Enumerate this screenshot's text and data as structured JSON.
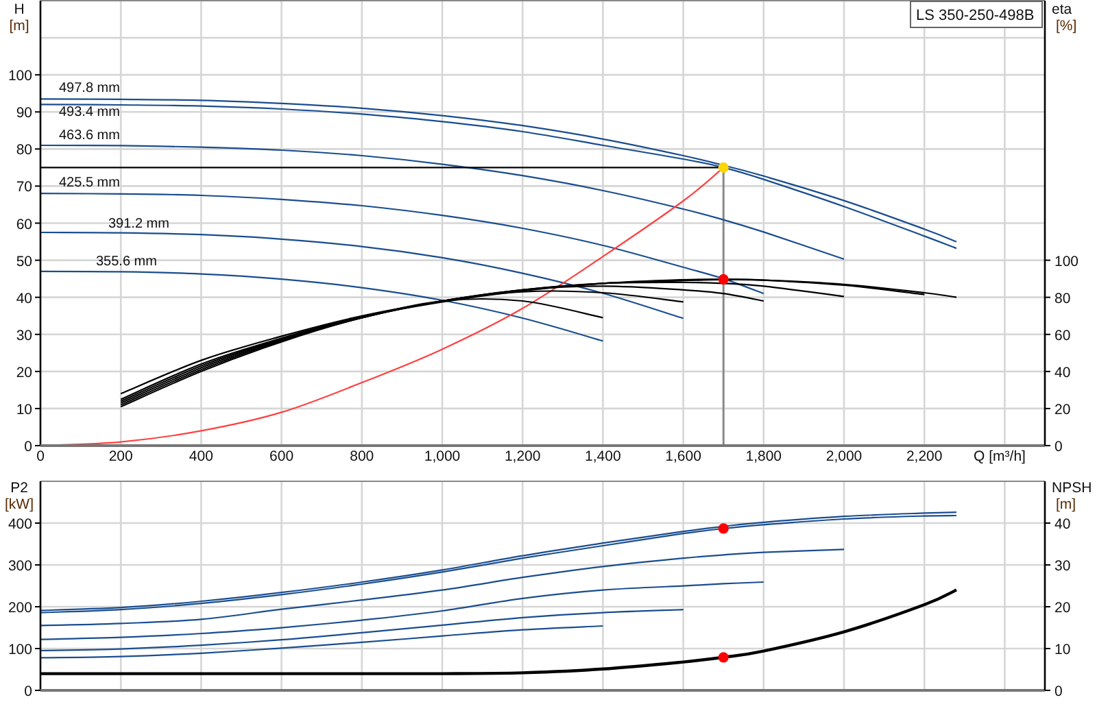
{
  "head_chart": {
    "axis_title": "H",
    "axis_unit": "[m]",
    "chart_data": {
      "type": "line",
      "title": "LS 350-250-498B",
      "xlabel": "Q [m³/h]",
      "grid": true,
      "xlim": [
        0,
        2500
      ],
      "ylim": [
        0,
        120
      ],
      "xticks": [
        0,
        200,
        400,
        600,
        800,
        {
          "value": 1000,
          "label": "1,000"
        },
        {
          "value": 1200,
          "label": "1,200"
        },
        {
          "value": 1400,
          "label": "1,400"
        },
        {
          "value": 1600,
          "label": "1,600"
        },
        {
          "value": 1800,
          "label": "1,800"
        },
        {
          "value": 2000,
          "label": "2,000"
        },
        {
          "value": 2200,
          "label": "2,200"
        }
      ],
      "yticks": [
        0,
        10,
        20,
        30,
        40,
        50,
        60,
        70,
        80,
        90,
        100
      ],
      "x": [
        0,
        200,
        400,
        600,
        800,
        1000,
        1200,
        1400,
        1600,
        1700,
        1800,
        2000,
        2200,
        2280
      ],
      "series": [
        {
          "name": "497.8 mm",
          "color": "#1a4d8f",
          "values": [
            93.5,
            93.4,
            93.1,
            92.3,
            91.0,
            89.0,
            86.3,
            82.7,
            78.2,
            75.6,
            72.7,
            66.1,
            58.4,
            55.0
          ]
        },
        {
          "name": "493.4 mm",
          "color": "#1a4d8f",
          "values": [
            92,
            91.9,
            91.6,
            90.8,
            89.4,
            87.4,
            84.7,
            81.0,
            77.3,
            75.0,
            71.8,
            64.5,
            56.5,
            53.2
          ]
        },
        {
          "name": "463.6 mm",
          "color": "#1a4d8f",
          "values": [
            81,
            80.9,
            80.5,
            79.7,
            78.2,
            75.9,
            72.8,
            68.8,
            63.8,
            60.9,
            57.6,
            50.3,
            null,
            null
          ]
        },
        {
          "name": "425.5 mm",
          "color": "#1a4d8f",
          "values": [
            68,
            67.9,
            67.5,
            66.4,
            64.7,
            62.1,
            58.6,
            54.0,
            48.1,
            45.0,
            41.0,
            null,
            null,
            null
          ]
        },
        {
          "name": "391.2 mm",
          "color": "#1a4d8f",
          "values": [
            57.5,
            57.4,
            56.9,
            55.7,
            53.7,
            50.7,
            46.5,
            41.1,
            34.3,
            null,
            null,
            null,
            null,
            null
          ]
        },
        {
          "name": "355.6 mm",
          "color": "#1a4d8f",
          "values": [
            47,
            46.9,
            46.3,
            44.9,
            42.6,
            39.2,
            34.4,
            28.2,
            null,
            null,
            null,
            null,
            null,
            null
          ]
        },
        {
          "color": "#ff4040",
          "values": [
            0,
            1,
            4,
            9,
            17,
            26,
            37,
            51,
            66,
            75,
            null,
            null,
            null,
            null
          ]
        },
        {
          "color": "#000000",
          "values": [
            75,
            75,
            75,
            75,
            75,
            75,
            75,
            75,
            75,
            75,
            null,
            null,
            null,
            null
          ]
        },
        {
          "color": "#ffd700",
          "marker": true,
          "values": [
            null,
            null,
            null,
            null,
            null,
            null,
            null,
            null,
            null,
            75,
            null,
            null,
            null,
            null
          ]
        }
      ],
      "ref_lines": [
        {
          "axis": "x",
          "value": 1700
        }
      ]
    }
  },
  "efficiency_chart": {
    "axis_title": "eta",
    "axis_unit": "[%]",
    "chart_data": {
      "type": "line",
      "xlim": [
        0,
        2500
      ],
      "ylim": [
        0,
        240
      ],
      "yticks": [
        0,
        20,
        40,
        60,
        80,
        100
      ],
      "x": [
        200,
        400,
        600,
        800,
        1000,
        1200,
        1400,
        1600,
        1700,
        1800,
        2000,
        2200,
        2280
      ],
      "series": [
        {
          "color": "#000000",
          "values": [
            28,
            46,
            59,
            70,
            78,
            84,
            87.5,
            89,
            89.5,
            89.3,
            87,
            82.5,
            80
          ]
        },
        {
          "color": "#000000",
          "values": [
            25,
            44,
            58,
            69.5,
            77.5,
            83.5,
            87.5,
            89.5,
            89.7,
            89.3,
            86.5,
            81.5,
            null
          ]
        },
        {
          "color": "#000000",
          "values": [
            24,
            43,
            57.5,
            69,
            78,
            84,
            87.5,
            88,
            87.5,
            86,
            80.5,
            null,
            null
          ]
        },
        {
          "color": "#000000",
          "values": [
            23,
            42,
            57,
            69,
            78,
            84,
            86,
            84,
            82,
            78,
            null,
            null,
            null
          ]
        },
        {
          "color": "#000000",
          "values": [
            22,
            41,
            56.5,
            69,
            78,
            83,
            82.5,
            77.5,
            null,
            null,
            null,
            null,
            null
          ]
        },
        {
          "color": "#000000",
          "values": [
            21,
            40,
            56,
            69,
            78,
            78,
            69,
            null,
            null,
            null,
            null,
            null,
            null
          ]
        },
        {
          "color": "#ff0000",
          "marker": true,
          "values": [
            null,
            null,
            null,
            null,
            null,
            null,
            null,
            null,
            89.7,
            null,
            null,
            null,
            null
          ]
        }
      ]
    }
  },
  "power_chart": {
    "axis_title": "P2",
    "axis_unit": "[kW]",
    "chart_data": {
      "type": "line",
      "grid": true,
      "xlim": [
        0,
        2500
      ],
      "ylim": [
        0,
        500
      ],
      "yticks": [
        0,
        100,
        200,
        300,
        400
      ],
      "x": [
        0,
        200,
        400,
        600,
        800,
        1000,
        1200,
        1400,
        1600,
        1700,
        1800,
        2000,
        2200,
        2280
      ],
      "series": [
        {
          "color": "#1a4d8f",
          "values": [
            191,
            198,
            213,
            234,
            259,
            288,
            322,
            352,
            380,
            392,
            402,
            416,
            424,
            426
          ]
        },
        {
          "color": "#1a4d8f",
          "values": [
            186,
            193,
            208,
            229,
            254,
            283,
            316,
            346,
            375,
            387,
            396,
            410,
            417,
            418
          ]
        },
        {
          "color": "#1a4d8f",
          "values": [
            155,
            160,
            170,
            194,
            216,
            240,
            270,
            296,
            316,
            324,
            330,
            337,
            null,
            null
          ]
        },
        {
          "color": "#1a4d8f",
          "values": [
            122,
            127,
            136,
            150,
            168,
            190,
            220,
            240,
            250,
            255,
            259,
            null,
            null,
            null
          ]
        },
        {
          "color": "#1a4d8f",
          "values": [
            95,
            99,
            108,
            121,
            138,
            156,
            174,
            186,
            193,
            null,
            null,
            null,
            null,
            null
          ]
        },
        {
          "color": "#1a4d8f",
          "values": [
            78,
            81,
            89,
            101,
            115,
            130,
            145,
            154,
            null,
            null,
            null,
            null,
            null,
            null
          ]
        },
        {
          "color": "#ff0000",
          "marker": true,
          "values": [
            null,
            null,
            null,
            null,
            null,
            null,
            null,
            null,
            null,
            387,
            null,
            null,
            null,
            null
          ]
        }
      ]
    }
  },
  "npsh_chart": {
    "axis_title": "NPSH",
    "axis_unit": "[m]",
    "chart_data": {
      "type": "line",
      "xlim": [
        0,
        2500
      ],
      "ylim": [
        0,
        50
      ],
      "yticks": [
        0,
        10,
        20,
        30,
        40
      ],
      "x": [
        0,
        200,
        400,
        600,
        800,
        1000,
        1200,
        1400,
        1600,
        1700,
        1800,
        2000,
        2200,
        2280
      ],
      "series": [
        {
          "color": "#000000",
          "values": [
            4,
            4,
            4,
            4,
            4,
            4,
            4.2,
            5.1,
            6.8,
            7.9,
            9.4,
            14,
            20.5,
            24
          ]
        },
        {
          "color": "#ff0000",
          "marker": true,
          "values": [
            null,
            null,
            null,
            null,
            null,
            null,
            null,
            null,
            null,
            7.9,
            null,
            null,
            null,
            null
          ]
        }
      ]
    }
  }
}
